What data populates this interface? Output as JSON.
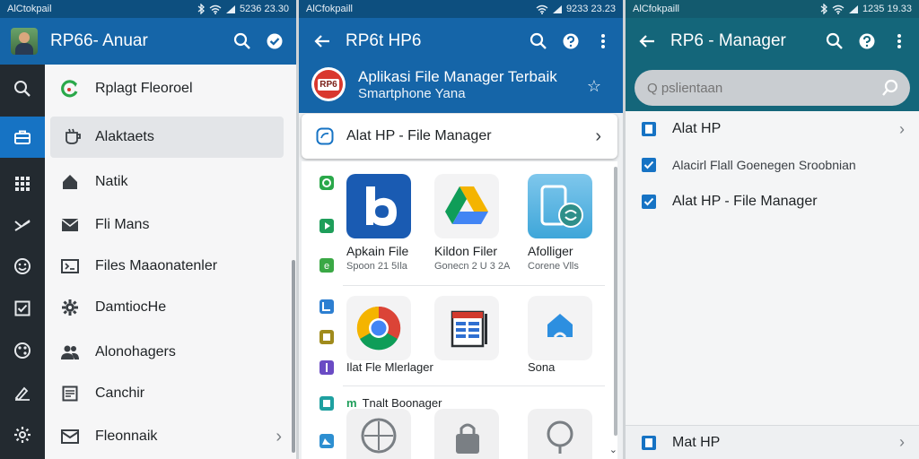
{
  "panels": {
    "left": {
      "status": {
        "carrier": "AlCtokpail",
        "time": "5236 23.30"
      },
      "title": "RP66- Anuar",
      "rail_icons": [
        "search-icon",
        "briefcase-icon",
        "grid-icon",
        "shuffle-icon",
        "face-icon",
        "checkbox-icon",
        "palette-icon",
        "edit-icon",
        "settings-icon"
      ],
      "items": [
        {
          "label": "Rplagt Fleoroel",
          "icon": "refresh-icon",
          "color": "#2aa84a"
        },
        {
          "label": "Alaktaets",
          "icon": "cup-icon",
          "color": "#3a3f44"
        },
        {
          "label": "Natik",
          "icon": "home-icon",
          "color": "#3a3f44"
        },
        {
          "label": "Fli Mans",
          "icon": "mail-icon",
          "color": "#3a3f44"
        },
        {
          "label": "Files Maaonatenler",
          "icon": "folder-icon",
          "color": "#3a3f44"
        },
        {
          "label": "DamtiocHe",
          "icon": "gear-icon",
          "color": "#3a3f44"
        },
        {
          "label": "Alonohagers",
          "icon": "people-icon",
          "color": "#3a3f44"
        },
        {
          "label": "Canchir",
          "icon": "note-icon",
          "color": "#3a3f44"
        },
        {
          "label": "Fleonnaik",
          "icon": "inbox-icon",
          "color": "#3a3f44"
        }
      ]
    },
    "middle": {
      "status": {
        "carrier": "AlCfokpaill",
        "time": "9233 23.23"
      },
      "title": "RP6t HP6",
      "hero_title": "Aplikasi File Manager Terbaik",
      "hero_subtitle": "Smartphone Yana",
      "badge": "RP6",
      "card_title": "Alat HP - File Manager",
      "apps_row1": [
        {
          "name": "Apkain File",
          "sub": "Spoon 21 5Ila"
        },
        {
          "name": "Kildon Filer",
          "sub": "Gonecn 2 U 3 2A"
        },
        {
          "name": "Afolliger",
          "sub": "Corene Vlls"
        }
      ],
      "apps_row2": [
        {
          "name": "Ilat Fle Mlerlager",
          "sub": ""
        },
        {
          "name": "",
          "sub": ""
        },
        {
          "name": "Sona",
          "sub": ""
        }
      ],
      "row3_label": "Tnalt Boonager",
      "row3_prefix": "m"
    },
    "right": {
      "status": {
        "carrier": "AlCfokpaill",
        "time": "1235 19.33"
      },
      "title": "RP6 - Manager",
      "search_placeholder": "Q pslientaan",
      "items": [
        {
          "label": "Alat HP"
        },
        {
          "label": "Alacirl Flall Goenegen Sroobnian"
        },
        {
          "label": "Alat HP - File Manager"
        }
      ],
      "bottom_item": "Mat HP"
    }
  },
  "colors": {
    "appbar": "#1565a8",
    "status": "#0d4f7f",
    "rail": "#232a30",
    "accent": "#1673c4",
    "teal": "#14667a"
  }
}
